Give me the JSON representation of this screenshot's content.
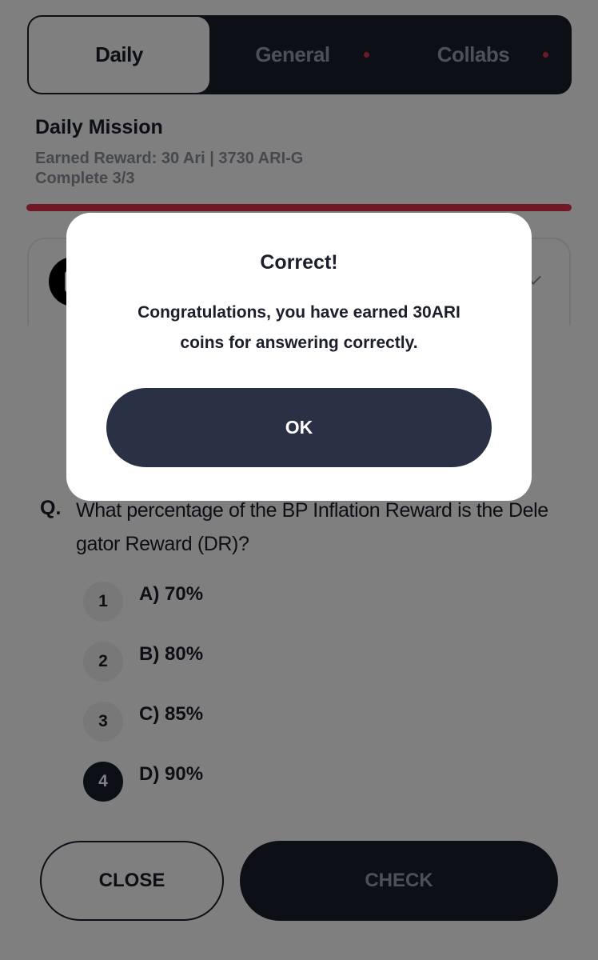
{
  "tabs": [
    {
      "label": "Daily",
      "active": true,
      "has_dot": false
    },
    {
      "label": "General",
      "active": false,
      "has_dot": true
    },
    {
      "label": "Collabs",
      "active": false,
      "has_dot": true
    }
  ],
  "mission": {
    "title": "Daily Mission",
    "reward_line": "Earned Reward: 30 Ari | 3730 ARI-G",
    "complete_line": "Complete 3/3",
    "progress_fraction": 1.0,
    "progress_color": "#e0334a"
  },
  "quiz": {
    "question_prefix": "Q.",
    "question": "What percentage of the BP Inflation Reward is the Delegator Reward (DR)?",
    "options": [
      {
        "number": "1",
        "text": "A) 70%",
        "selected": false
      },
      {
        "number": "2",
        "text": "B) 80%",
        "selected": false
      },
      {
        "number": "3",
        "text": "C) 85%",
        "selected": false
      },
      {
        "number": "4",
        "text": "D) 90%",
        "selected": true
      }
    ],
    "close_label": "CLOSE",
    "check_label": "CHECK"
  },
  "modal": {
    "title": "Correct!",
    "message": "Congratulations, you have earned 30ARI coins for answering correctly.",
    "ok_label": "OK"
  },
  "colors": {
    "primary_dark": "#1a1f2e",
    "accent_red": "#e0334a"
  }
}
